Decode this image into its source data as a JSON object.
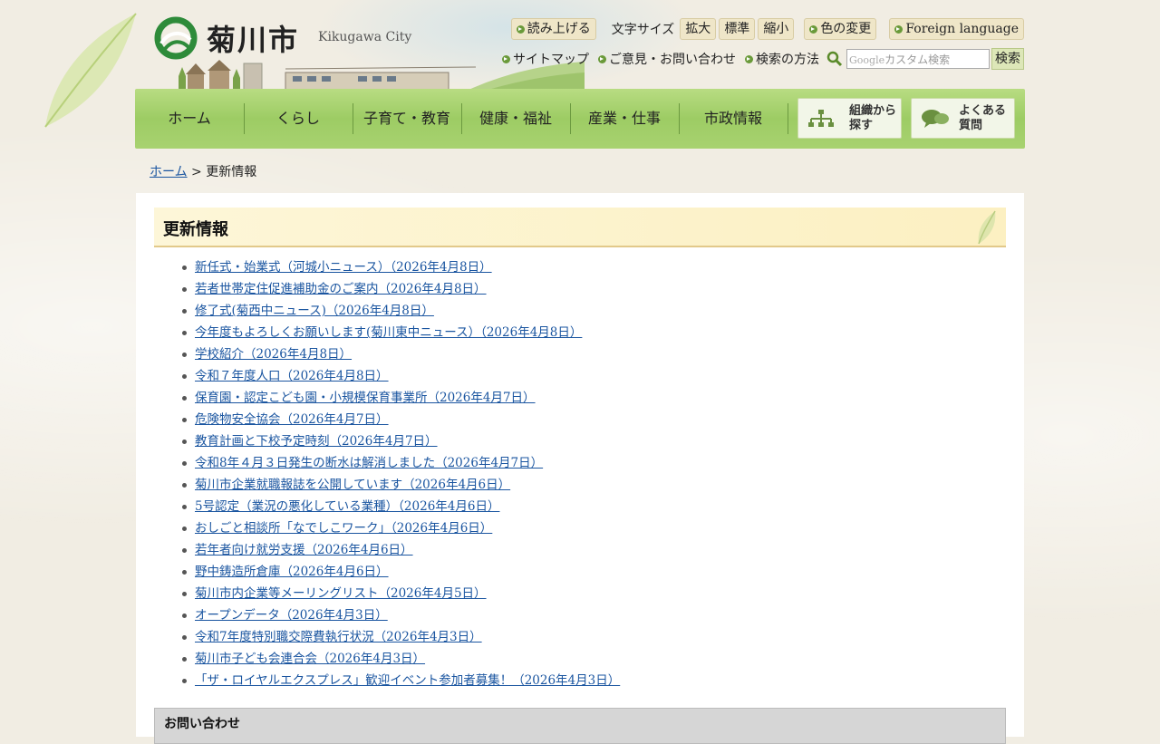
{
  "header": {
    "logo_jp": "菊川市",
    "logo_en": "Kikugawa City",
    "read_aloud": "読み上げる",
    "font_size_label": "文字サイズ",
    "font_enlarge": "拡大",
    "font_standard": "標準",
    "font_reduce": "縮小",
    "color_change": "色の変更",
    "foreign_language": "Foreign language",
    "sitemap": "サイトマップ",
    "feedback": "ご意見・お問い合わせ",
    "search_method": "検索の方法",
    "search_placeholder": "カスタム検索",
    "search_brand": "Google",
    "search_button": "検索"
  },
  "nav": {
    "items": [
      "ホーム",
      "くらし",
      "子育て・教育",
      "健康・福祉",
      "産業・仕事",
      "市政情報"
    ],
    "org_search": "組織から探す",
    "org_search_l1": "組織から",
    "org_search_l2": "探す",
    "faq_l1": "よくある",
    "faq_l2": "質問"
  },
  "breadcrumb": {
    "home": "ホーム",
    "separator": ">",
    "current": "更新情報"
  },
  "main": {
    "title": "更新情報",
    "updates": [
      "新任式・始業式（河城小ニュース）（2026年4月8日）",
      "若者世帯定住促進補助金のご案内（2026年4月8日）",
      "修了式(菊西中ニュース)（2026年4月8日）",
      "今年度もよろしくお願いします(菊川東中ニュース）（2026年4月8日）",
      "学校紹介（2026年4月8日）",
      "令和７年度人口（2026年4月8日）",
      "保育園・認定こども園・小規模保育事業所（2026年4月7日）",
      "危険物安全協会（2026年4月7日）",
      "教育計画と下校予定時刻（2026年4月7日）",
      "令和8年４月３日発生の断水は解消しました（2026年4月7日）",
      "菊川市企業就職報誌を公開しています（2026年4月6日）",
      "5号認定（業況の悪化している業種）（2026年4月6日）",
      "おしごと相談所「なでしこワーク」（2026年4月6日）",
      "若年者向け就労支援（2026年4月6日）",
      "野中鋳造所倉庫（2026年4月6日）",
      "菊川市内企業等メーリングリスト（2026年4月5日）",
      "オープンデータ（2026年4月3日）",
      "令和7年度特別職交際費執行状況（2026年4月3日）",
      "菊川市子ども会連合会（2026年4月3日）",
      "「ザ・ロイヤルエクスプレス」歓迎イベント参加者募集！（2026年4月3日）"
    ],
    "inquiry_title": "お問い合わせ"
  },
  "colors": {
    "nav_green": "#9dcc64",
    "link_blue": "#1a55a0",
    "title_band": "#fcf0c2"
  }
}
